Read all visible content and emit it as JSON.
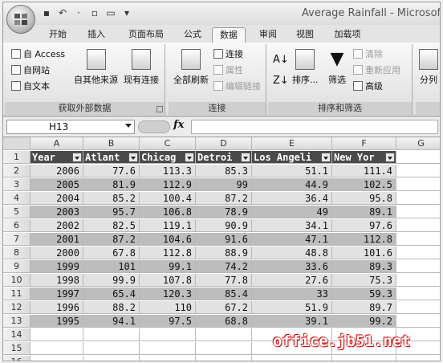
{
  "window": {
    "title": "Average Rainfall - Microsoft E"
  },
  "qat": {
    "icons": [
      "save-icon",
      "undo-icon",
      "redo-icon",
      "new-icon",
      "open-icon",
      "customize-icon"
    ]
  },
  "tabs": [
    "开始",
    "插入",
    "页面布局",
    "公式",
    "数据",
    "审阅",
    "视图",
    "加载项"
  ],
  "active_tab": "数据",
  "ribbon": {
    "get_external": {
      "label": "获取外部数据",
      "from_access": "自 Access",
      "from_web": "自网站",
      "from_text": "自文本",
      "from_other": "自其他来源",
      "existing": "现有连接"
    },
    "connections": {
      "label": "连接",
      "refresh_all": "全部刷新",
      "connections": "连接",
      "properties": "属性",
      "edit_links": "编辑链接"
    },
    "sort_filter": {
      "label": "排序和筛选",
      "sort": "排序...",
      "filter": "筛选",
      "clear": "清除",
      "reapply": "重新应用",
      "advanced": "高级"
    },
    "tools": {
      "split": "分列"
    }
  },
  "formula_bar": {
    "name_box": "H13",
    "fx": "fx",
    "formula": ""
  },
  "columns": [
    "A",
    "B",
    "C",
    "D",
    "E",
    "F",
    "G"
  ],
  "rows": [
    "1",
    "2",
    "3",
    "4",
    "5",
    "6",
    "7",
    "8",
    "9",
    "10",
    "11",
    "12",
    "13",
    "14",
    "15",
    "16"
  ],
  "table": {
    "headers": [
      "Year",
      "Atlant",
      "Chicag",
      "Detroi",
      "Los Angeli",
      "New Yor"
    ],
    "data": [
      [
        "2006",
        "77.6",
        "113.3",
        "85.3",
        "51.1",
        "111.4"
      ],
      [
        "2005",
        "81.9",
        "112.9",
        "99",
        "44.9",
        "102.5"
      ],
      [
        "2004",
        "85.2",
        "100.4",
        "87.2",
        "36.4",
        "95.8"
      ],
      [
        "2003",
        "95.7",
        "106.8",
        "78.9",
        "49",
        "89.1"
      ],
      [
        "2002",
        "82.5",
        "119.1",
        "90.9",
        "34.1",
        "97.6"
      ],
      [
        "2001",
        "87.2",
        "104.6",
        "91.6",
        "47.1",
        "112.8"
      ],
      [
        "2000",
        "67.8",
        "112.8",
        "88.9",
        "48.8",
        "101.6"
      ],
      [
        "1999",
        "101",
        "99.1",
        "74.2",
        "33.6",
        "89.3"
      ],
      [
        "1998",
        "99.9",
        "107.8",
        "77.8",
        "27.6",
        "75.3"
      ],
      [
        "1997",
        "65.4",
        "120.3",
        "85.4",
        "33",
        "59.3"
      ],
      [
        "1996",
        "88.2",
        "110",
        "67.2",
        "51.9",
        "89.7"
      ],
      [
        "1995",
        "94.1",
        "97.5",
        "68.8",
        "39.1",
        "99.2"
      ]
    ]
  },
  "watermark": "office.jb51.net"
}
